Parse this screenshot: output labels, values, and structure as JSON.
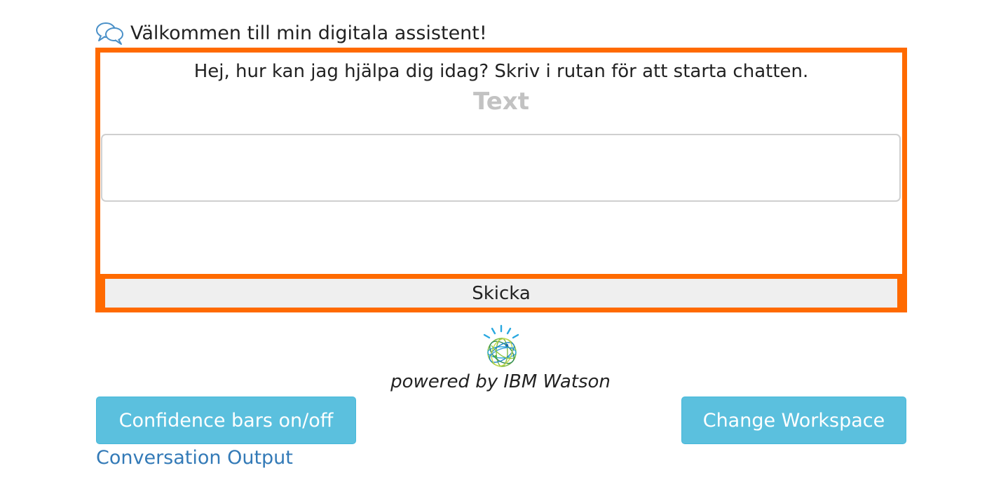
{
  "header": {
    "icon": "chat-bubbles-icon",
    "title": "Välkommen till min digitala assistent!"
  },
  "chat": {
    "greeting": "Hej, hur kan jag hjälpa dig idag? Skriv i rutan för att starta chatten.",
    "heading": "Text",
    "input_value": "",
    "send_label": "Skicka",
    "border_color": "#ff6a00"
  },
  "branding": {
    "logo_icon": "ibm-watson-logo-icon",
    "powered_by": "powered by IBM Watson"
  },
  "actions": {
    "confidence_label": "Confidence bars on/off",
    "workspace_label": "Change Workspace",
    "button_color": "#5bc0de",
    "conversation_output_link": "Conversation Output",
    "link_color": "#337ab7"
  }
}
